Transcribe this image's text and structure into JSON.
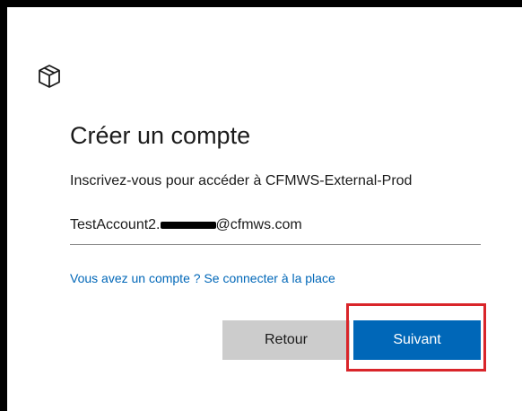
{
  "dialog": {
    "logo_icon": "package-icon",
    "title": "Créer un compte",
    "subtitle": "Inscrivez-vous pour accéder à CFMWS-External-Prod",
    "email_value": "TestAccount2.█████@cfmws.com",
    "email_prefix": "TestAccount2.",
    "email_suffix": "@cfmws.com",
    "signin_link": "Vous avez un compte ? Se connecter à la place",
    "back_label": "Retour",
    "next_label": "Suivant"
  },
  "colors": {
    "accent": "#0067b8",
    "secondary_button": "#cccccc",
    "highlight": "#d9252a"
  }
}
